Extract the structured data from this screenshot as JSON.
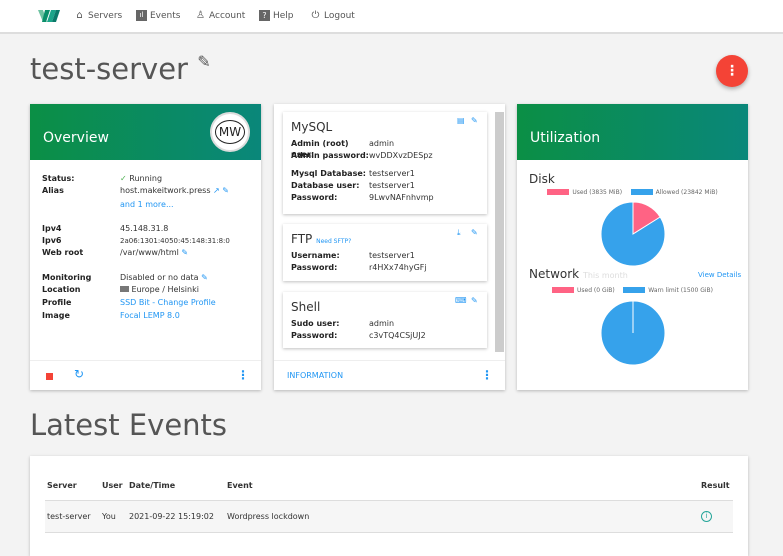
{
  "nav": {
    "items": [
      {
        "label": "Servers",
        "icon": "home-icon"
      },
      {
        "label": "Events",
        "icon": "chart-icon"
      },
      {
        "label": "Account",
        "icon": "user-icon"
      },
      {
        "label": "Help",
        "icon": "help-icon"
      },
      {
        "label": "Logout",
        "icon": "power-icon"
      }
    ]
  },
  "page": {
    "title": "test-server",
    "menu": "⋮"
  },
  "overview": {
    "title": "Overview",
    "logo": "MW",
    "rows": [
      {
        "k": "Status:",
        "v": "Running"
      },
      {
        "k": "Alias",
        "v": "host.makeitwork.press",
        "more": "and 1 more..."
      },
      {
        "k": "Ipv4",
        "v": "45.148.31.8"
      },
      {
        "k": "Ipv6",
        "v": "2a06:1301:4050:45:148:31:8:0"
      },
      {
        "k": "Web root",
        "v": "/var/www/html"
      },
      {
        "k": "Monitoring",
        "v": "Disabled or no data"
      },
      {
        "k": "Location",
        "v": "Europe / Helsinki"
      },
      {
        "k": "Profile",
        "v": "SSD Bit - Change Profile"
      },
      {
        "k": "Image",
        "v": "Focal LEMP 8.0"
      }
    ]
  },
  "info": {
    "footer": "INFORMATION",
    "mysql": {
      "title": "MySQL",
      "rows": [
        {
          "k": "Admin (root) user:",
          "v": "admin"
        },
        {
          "k": "Admin password:",
          "v": "wvDDXvzDESpz"
        },
        {
          "k": "Mysql Database:",
          "v": "testserver1"
        },
        {
          "k": "Database user:",
          "v": "testserver1"
        },
        {
          "k": "Password:",
          "v": "9LwvNAFnhvmp"
        }
      ]
    },
    "ftp": {
      "title": "FTP",
      "link": "Need SFTP?",
      "rows": [
        {
          "k": "Username:",
          "v": "testserver1"
        },
        {
          "k": "Password:",
          "v": "r4HXx74hyGFj"
        }
      ]
    },
    "shell": {
      "title": "Shell",
      "rows": [
        {
          "k": "Sudo user:",
          "v": "admin"
        },
        {
          "k": "Password:",
          "v": "c3vTQ4CSjUJ2"
        }
      ]
    }
  },
  "utilization": {
    "title": "Utilization",
    "chart_data": [
      {
        "type": "pie",
        "title": "Disk",
        "series": [
          {
            "name": "Used (3835 MiB)",
            "value": 3835,
            "color": "#ff6384"
          },
          {
            "name": "Allowed (23842 MiB)",
            "value": 23842,
            "color": "#36a2eb"
          }
        ]
      },
      {
        "type": "pie",
        "title": "Network",
        "subtitle": "This month",
        "series": [
          {
            "name": "Used (0 GiB)",
            "value": 0,
            "color": "#ff6384"
          },
          {
            "name": "Warn limit (1500 GiB)",
            "value": 1500,
            "color": "#36a2eb"
          }
        ]
      }
    ],
    "view_details": "View Details"
  },
  "events": {
    "title": "Latest Events",
    "columns": [
      "Server",
      "User",
      "Date/Time",
      "Event",
      "Result"
    ],
    "rows": [
      {
        "server": "test-server",
        "user": "You",
        "datetime": "2021-09-22 15:19:02",
        "event": "Wordpress lockdown",
        "result": "info-icon"
      }
    ]
  }
}
